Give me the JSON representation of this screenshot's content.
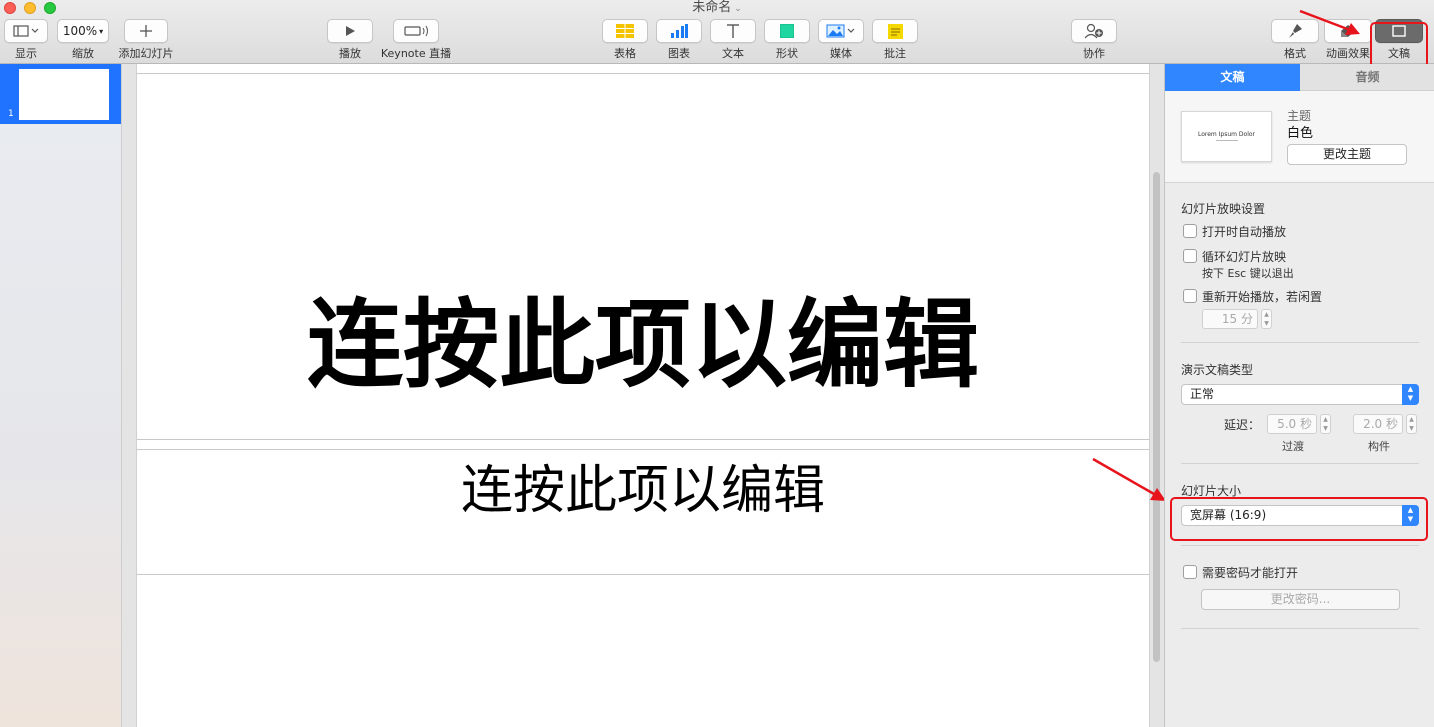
{
  "window": {
    "title": "未命名"
  },
  "toolbar": {
    "view": {
      "label": "显示",
      "icon": "sidebar-view-icon"
    },
    "zoom": {
      "label": "缩放",
      "value": "100%"
    },
    "add_slide": {
      "label": "添加幻灯片",
      "icon": "plus-icon"
    },
    "play": {
      "label": "播放",
      "icon": "play-icon"
    },
    "keynote_live": {
      "label": "Keynote 直播",
      "icon": "keynote-live-icon"
    },
    "table": {
      "label": "表格",
      "icon": "table-icon",
      "color": "#f5c400"
    },
    "chart": {
      "label": "图表",
      "icon": "chart-icon",
      "color": "#1a7cf5"
    },
    "text": {
      "label": "文本",
      "icon": "text-icon"
    },
    "shape": {
      "label": "形状",
      "icon": "shape-icon",
      "color": "#1fd6a0"
    },
    "media": {
      "label": "媒体",
      "icon": "media-icon"
    },
    "comment": {
      "label": "批注",
      "icon": "comment-icon",
      "color": "#f5d800"
    },
    "collaborate": {
      "label": "协作",
      "icon": "collaborate-icon"
    },
    "format": {
      "label": "格式",
      "icon": "format-brush-icon"
    },
    "animate": {
      "label": "动画效果",
      "icon": "animate-diamond-icon"
    },
    "document": {
      "label": "文稿",
      "icon": "document-icon"
    }
  },
  "navigator": {
    "slides": [
      {
        "number": "1"
      }
    ]
  },
  "slide": {
    "title": "连按此项以编辑",
    "subtitle": "连按此项以编辑"
  },
  "inspector": {
    "tabs": [
      {
        "label": "文稿",
        "active": true
      },
      {
        "label": "音频",
        "active": false
      }
    ],
    "theme": {
      "heading": "主题",
      "name": "白色",
      "change_button": "更改主题",
      "preview_text": "Lorem Ipsum Dolor"
    },
    "slideshow": {
      "heading": "幻灯片放映设置",
      "autoplay": "打开时自动播放",
      "loop": "循环幻灯片放映",
      "loop_hint": "按下 Esc 键以退出",
      "restart": "重新开始播放，若闲置",
      "idle_minutes": "15 分"
    },
    "presentation_type": {
      "heading": "演示文稿类型",
      "value": "正常",
      "delay_label": "延迟：",
      "transition_value": "5.0 秒",
      "transition_label": "过渡",
      "build_value": "2.0 秒",
      "build_label": "构件"
    },
    "slide_size": {
      "heading": "幻灯片大小",
      "value": "宽屏幕 (16:9)"
    },
    "password": {
      "require": "需要密码才能打开",
      "change_button": "更改密码..."
    }
  },
  "annotation_color": "#e8141c"
}
